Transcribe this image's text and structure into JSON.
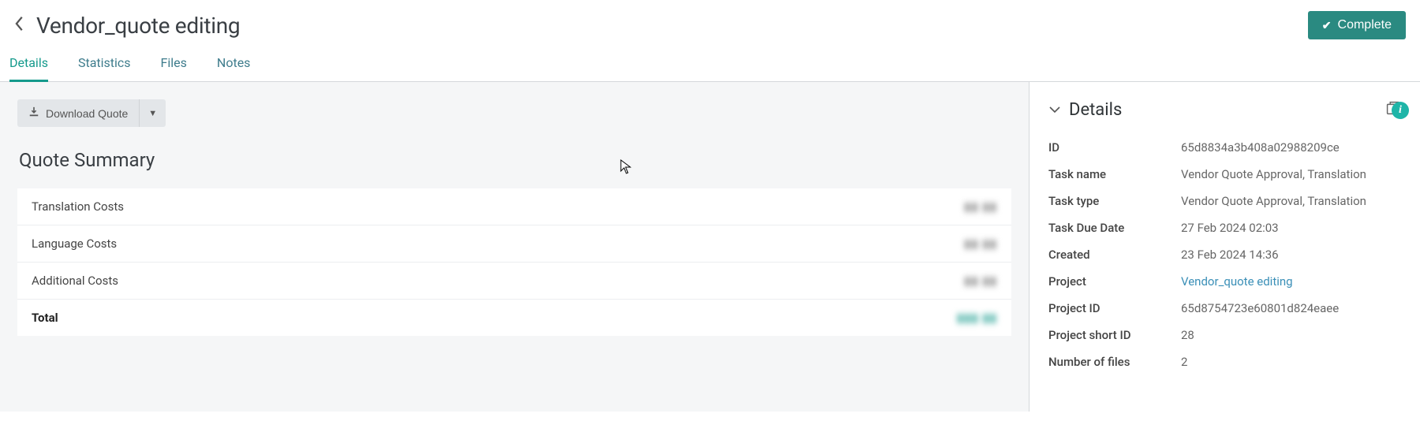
{
  "header": {
    "title": "Vendor_quote editing",
    "complete_label": "Complete"
  },
  "tabs": [
    {
      "label": "Details",
      "active": true
    },
    {
      "label": "Statistics",
      "active": false
    },
    {
      "label": "Files",
      "active": false
    },
    {
      "label": "Notes",
      "active": false
    }
  ],
  "toolbar": {
    "download_label": "Download Quote"
  },
  "summary": {
    "title": "Quote Summary",
    "rows": [
      {
        "label": "Translation Costs",
        "value": "▮▮ ▮▮",
        "blur": true
      },
      {
        "label": "Language Costs",
        "value": "▮▮ ▮▮",
        "blur": true
      },
      {
        "label": "Additional Costs",
        "value": "▮▮ ▮▮",
        "blur": true
      }
    ],
    "total_label": "Total",
    "total_value": "▮▮▮ ▮▮"
  },
  "side": {
    "title": "Details",
    "rows": [
      {
        "label": "ID",
        "value": "65d8834a3b408a02988209ce"
      },
      {
        "label": "Task name",
        "value": "Vendor Quote Approval, Translation"
      },
      {
        "label": "Task type",
        "value": "Vendor Quote Approval, Translation"
      },
      {
        "label": "Task Due Date",
        "value": "27 Feb 2024 02:03"
      },
      {
        "label": "Created",
        "value": "23 Feb 2024 14:36"
      },
      {
        "label": "Project",
        "value": "Vendor_quote editing",
        "link": true
      },
      {
        "label": "Project ID",
        "value": "65d8754723e60801d824eaee"
      },
      {
        "label": "Project short ID",
        "value": "28"
      },
      {
        "label": "Number of files",
        "value": "2"
      }
    ]
  }
}
